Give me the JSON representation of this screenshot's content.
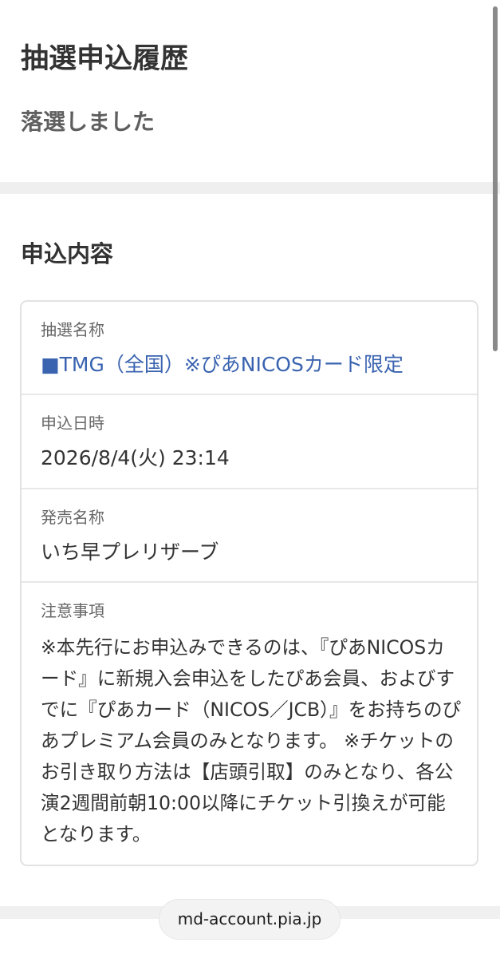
{
  "page": {
    "title": "抽選申込履歴",
    "status": "落選しました"
  },
  "application": {
    "section_title": "申込内容",
    "lottery_name": {
      "label": "抽選名称",
      "value": "■TMG（全国）※ぴあNICOSカード限定"
    },
    "applied_at": {
      "label": "申込日時",
      "value": "2026/8/4(火) 23:14"
    },
    "sale_name": {
      "label": "発売名称",
      "value": "いち早プレリザーブ"
    },
    "notes": {
      "label": "注意事項",
      "value": "※本先行にお申込みできるのは、『ぴあNICOSカード』に新規入会申込をしたぴあ会員、およびすでに『ぴあカード（NICOS／JCB）』をお持ちのぴあプレミアム会員のみとなります。 ※チケットのお引き取り方法は【店頭引取】のみとなり、各公演2週間前朝10:00以降にチケット引換えが可能となります。"
    }
  },
  "browser": {
    "url": "md-account.pia.jp"
  },
  "colors": {
    "link": "#3a63b0",
    "divider": "#efefef"
  }
}
